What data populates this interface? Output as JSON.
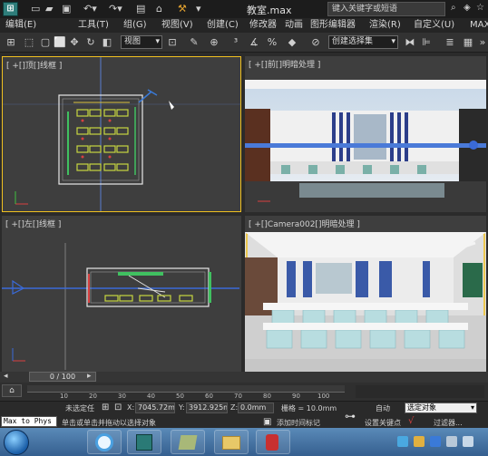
{
  "titlebar": {
    "doc_title": "教室.max",
    "search_placeholder": "键入关键字或短语",
    "max_label": "MAX"
  },
  "menu": [
    "编辑(E)",
    "工具(T)",
    "组(G)",
    "视图(V)",
    "创建(C)",
    "修改器",
    "动画",
    "图形编辑器",
    "渲染(R)",
    "自定义(U)"
  ],
  "toolbar": {
    "view_dropdown": "视图",
    "selection_set_dropdown": "创建选择集"
  },
  "viewports": {
    "top": {
      "label": "[ +[]顶[]线框 ]"
    },
    "front": {
      "label": "[ +[]前[]明暗处理 ]"
    },
    "left": {
      "label": "[ +[]左[]线框 ]"
    },
    "camera": {
      "label": "[ +[]Camera002[]明暗处理 ]"
    }
  },
  "timeslider": {
    "frame_counter": "0 / 100"
  },
  "trackbar": {
    "ticks": [
      "10",
      "20",
      "30",
      "40",
      "50",
      "60",
      "70",
      "80",
      "90",
      "100"
    ]
  },
  "statusbar": {
    "max_to_physx": "Max to Phys",
    "selection_status": "未选定任",
    "prompt": "单击或单击并拖动以选择对象",
    "x_label": "X:",
    "x_value": "7045.72m",
    "y_label": "Y:",
    "y_value": "3912.925m",
    "z_label": "Z:",
    "z_value": "0.0mm",
    "grid": "栅格 = 10.0mm",
    "add_time_tag": "添加时间标记",
    "auto_key": "自动",
    "key_mode_dropdown": "选定对象",
    "set_key": "设置关键点",
    "key_filters": "过滤器..."
  },
  "colors": {
    "active_border": "#f0c020",
    "viewport_bg": "#3e3e3e",
    "taskbar": "#355f8f"
  }
}
